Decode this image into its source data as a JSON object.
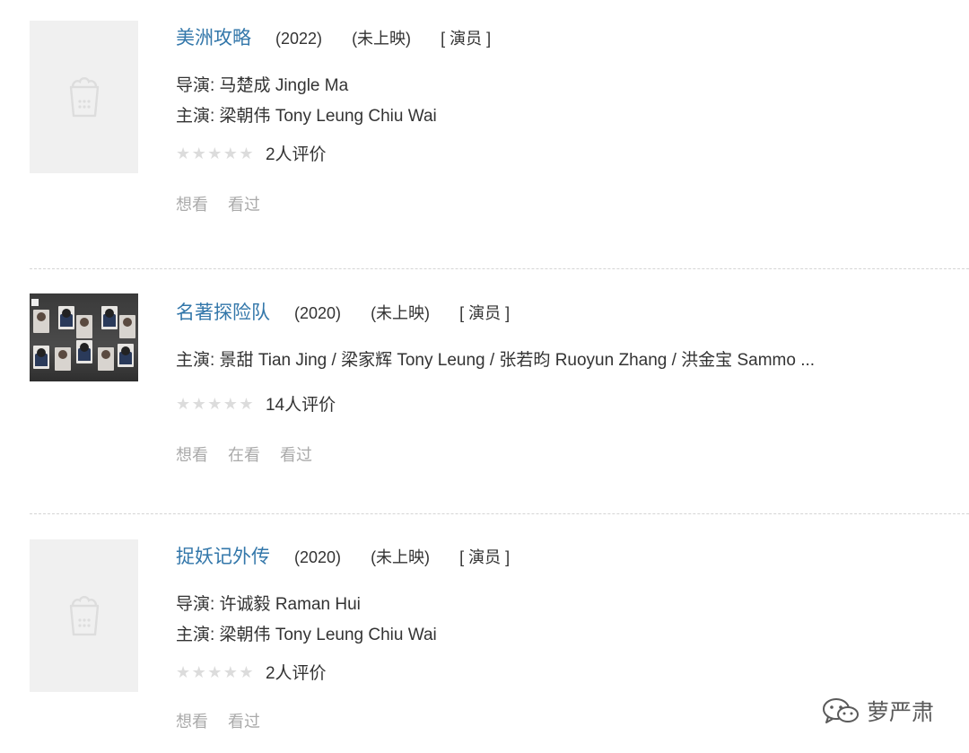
{
  "items": [
    {
      "title": "美洲攻略",
      "year": "(2022)",
      "status": "(未上映)",
      "role": "[ 演员 ]",
      "director": "导演: 马楚成 Jingle Ma",
      "cast": "主演: 梁朝伟 Tony Leung Chiu Wai",
      "rating_count": "2人评价",
      "rating_value": 0,
      "actions": [
        "想看",
        "看过"
      ],
      "poster": "placeholder-icon"
    },
    {
      "title": "名著探险队",
      "year": "(2020)",
      "status": "(未上映)",
      "role": "[ 演员 ]",
      "cast": "主演: 景甜 Tian Jing / 梁家辉 Tony Leung / 张若昀 Ruoyun Zhang / 洪金宝 Sammo ...",
      "rating_count": "14人评价",
      "rating_value": 0,
      "actions": [
        "想看",
        "在看",
        "看过"
      ],
      "poster": "photo"
    },
    {
      "title": "捉妖记外传",
      "year": "(2020)",
      "status": "(未上映)",
      "role": "[ 演员 ]",
      "director": "导演: 许诚毅 Raman Hui",
      "cast": "主演: 梁朝伟 Tony Leung Chiu Wai",
      "rating_count": "2人评价",
      "rating_value": 0,
      "actions": [
        "想看",
        "看过"
      ],
      "poster": "placeholder-icon"
    }
  ],
  "watermark": {
    "text": "萝严肃",
    "icon": "wechat-icon"
  },
  "colors": {
    "link": "#3377aa",
    "action": "#aaaaaa",
    "star_empty": "#dcdcdc",
    "divider": "#d5d5d5"
  }
}
